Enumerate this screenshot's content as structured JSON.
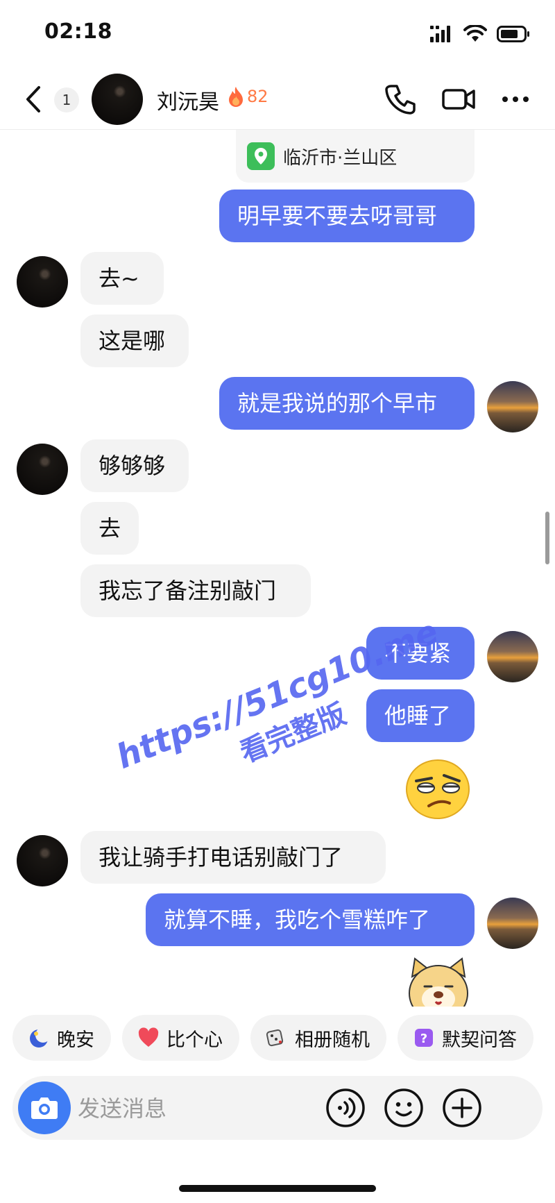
{
  "status_bar": {
    "time": "02:18"
  },
  "header": {
    "unread_count": "1",
    "contact_name": "刘沅昊",
    "streak_count": "82"
  },
  "chat": {
    "location": "临沂市·兰山区",
    "messages": [
      {
        "side": "out",
        "text": "明早要不要去呀哥哥"
      },
      {
        "side": "in",
        "text": "去~"
      },
      {
        "side": "in",
        "text": "这是哪"
      },
      {
        "side": "out",
        "text": "就是我说的那个早市"
      },
      {
        "side": "in",
        "text": "够够够"
      },
      {
        "side": "in",
        "text": "去"
      },
      {
        "side": "in",
        "text": "我忘了备注别敲门"
      },
      {
        "side": "out",
        "text": "不要紧"
      },
      {
        "side": "out",
        "text": "他睡了"
      },
      {
        "side": "in",
        "text": "我让骑手打电话别敲门了"
      },
      {
        "side": "out",
        "text": "就算不睡，我吃个雪糕咋了"
      }
    ],
    "watermark_line1": "https://51cg10.me",
    "watermark_line2": "看完整版"
  },
  "quick_replies": [
    {
      "label": "晚安",
      "icon": "moon-icon"
    },
    {
      "label": "比个心",
      "icon": "heart-icon"
    },
    {
      "label": "相册随机",
      "icon": "dice-icon"
    },
    {
      "label": "默契问答",
      "icon": "question-icon"
    }
  ],
  "composer": {
    "placeholder": "发送消息"
  },
  "colors": {
    "outgoing_bubble": "#5b74f0",
    "incoming_bubble": "#f3f3f3",
    "camera_button": "#3f7cf4",
    "streak": "#ff7a45"
  }
}
